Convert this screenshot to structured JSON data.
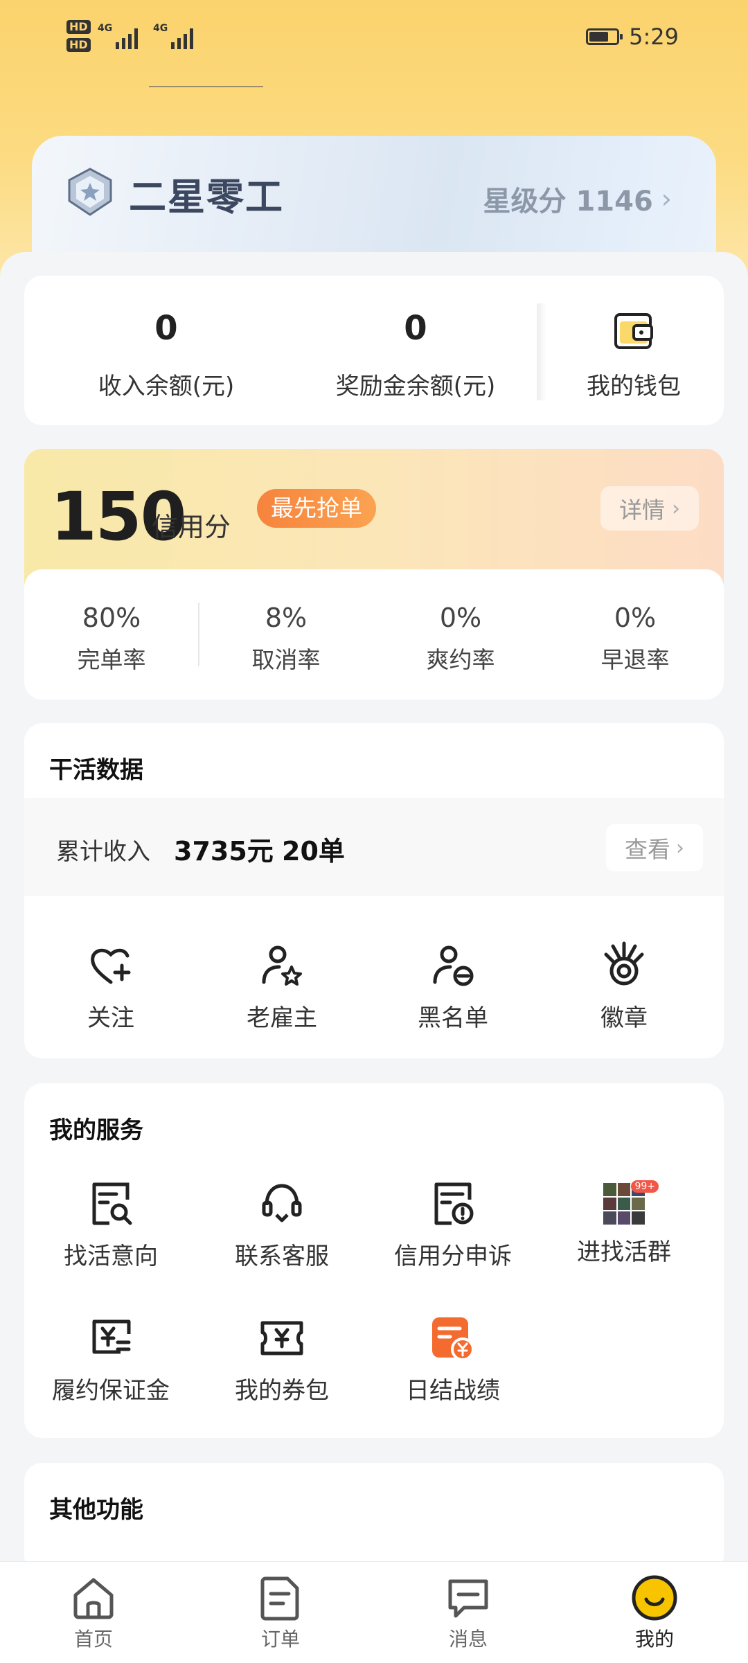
{
  "status_bar": {
    "sim1": "HD",
    "sim2": "HD",
    "network1": "4G",
    "network2": "4G",
    "battery_level": 0.7,
    "time": "5:29"
  },
  "level": {
    "title": "二星零工",
    "score_label": "星级分 1146"
  },
  "wallet": {
    "income_value": "0",
    "income_label": "收入余额(元)",
    "bonus_value": "0",
    "bonus_label": "奖励金余额(元)",
    "wallet_label": "我的钱包"
  },
  "credit": {
    "score": "150",
    "score_label": "信用分",
    "tag": "最先抢单",
    "detail_label": "详情",
    "stats": [
      {
        "value": "80%",
        "label": "完单率"
      },
      {
        "value": "8%",
        "label": "取消率"
      },
      {
        "value": "0%",
        "label": "爽约率"
      },
      {
        "value": "0%",
        "label": "早退率"
      }
    ]
  },
  "work_data": {
    "title": "干活数据",
    "income_label": "累计收入",
    "income_amount": "3735元",
    "order_count": "20单",
    "view_label": "查看",
    "items": [
      {
        "label": "关注",
        "icon": "heart-plus-icon"
      },
      {
        "label": "老雇主",
        "icon": "user-star-icon"
      },
      {
        "label": "黑名单",
        "icon": "user-block-icon"
      },
      {
        "label": "徽章",
        "icon": "medal-icon"
      }
    ]
  },
  "services": {
    "title": "我的服务",
    "items": [
      {
        "label": "找活意向",
        "icon": "search-doc-icon"
      },
      {
        "label": "联系客服",
        "icon": "headset-icon"
      },
      {
        "label": "信用分申诉",
        "icon": "appeal-doc-icon"
      },
      {
        "label": "进找活群",
        "icon": "group-thumbnail-icon",
        "badge": "99+"
      },
      {
        "label": "履约保证金",
        "icon": "deposit-icon"
      },
      {
        "label": "我的券包",
        "icon": "coupon-icon"
      },
      {
        "label": "日结战绩",
        "icon": "daily-record-icon"
      }
    ]
  },
  "other": {
    "title": "其他功能"
  },
  "bottom_nav": {
    "items": [
      {
        "label": "首页",
        "icon": "home-icon"
      },
      {
        "label": "订单",
        "icon": "order-icon"
      },
      {
        "label": "消息",
        "icon": "message-icon"
      },
      {
        "label": "我的",
        "icon": "profile-smile-icon",
        "active": true
      }
    ]
  },
  "colors": {
    "header_yellow": "#fbd36d",
    "accent_orange": "#f6833d",
    "active_nav": "#f8c400"
  }
}
